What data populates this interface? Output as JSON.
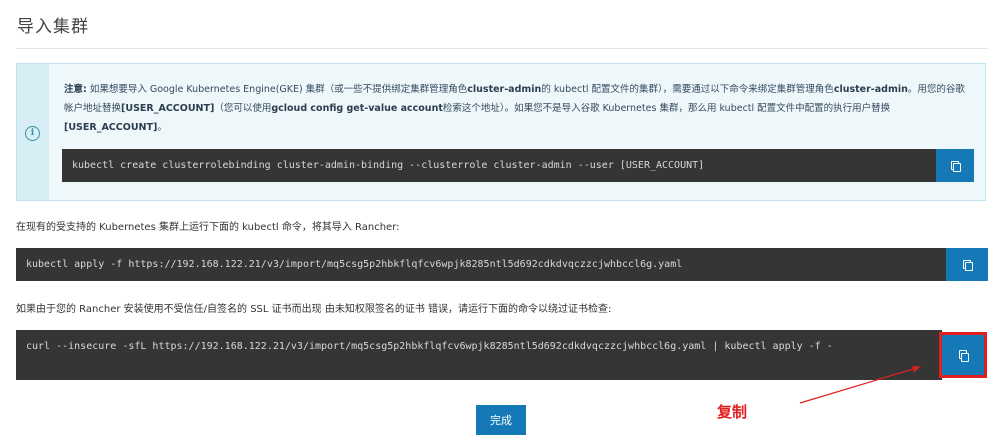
{
  "page": {
    "title": "导入集群"
  },
  "info_box": {
    "icon": "info-circle-icon",
    "note_prefix": "注意:",
    "note_1": " 如果想要导入 Google Kubernetes Engine(GKE) 集群（或一些不提供绑定集群管理角色",
    "note_b1": "cluster-admin",
    "note_2": "的 kubectl 配置文件的集群），需要通过以下命令来绑定集群管理角色",
    "note_b2": "cluster-admin",
    "note_3": "。用您的谷歌帐户地址替换",
    "note_b3": "[USER_ACCOUNT]",
    "note_4": "（您可以使用",
    "note_b4": "gcloud config get-value account",
    "note_5": "检索这个地址）。如果您不是导入谷歌 Kubernetes 集群，那么用 kubectl 配置文件中配置的执行用户替换",
    "note_b5": "[USER_ACCOUNT]",
    "note_6": "。",
    "command": "kubectl create clusterrolebinding cluster-admin-binding --clusterrole cluster-admin --user [USER_ACCOUNT]"
  },
  "section_import": {
    "label": "在现有的受支持的 Kubernetes 集群上运行下面的 kubectl 命令，将其导入 Rancher:",
    "command": "kubectl apply -f https://192.168.122.21/v3/import/mq5csg5p2hbkflqfcv6wpjk8285ntl5d692cdkdvqczzcjwhbccl6g.yaml"
  },
  "section_insecure": {
    "label": "如果由于您的 Rancher 安装使用不受信任/自签名的 SSL 证书而出现 由未知权限签名的证书 错误，请运行下面的命令以绕过证书检查:",
    "command": "curl --insecure -sfL https://192.168.122.21/v3/import/mq5csg5p2hbkflqfcv6wpjk8285ntl5d692cdkdvqczzcjwhbccl6g.yaml | kubectl apply -f -"
  },
  "buttons": {
    "done": "完成",
    "copy_icon": "copy-icon"
  },
  "annotation": {
    "text": "复制",
    "color": "#e02020"
  },
  "colors": {
    "accent": "#1679b7",
    "code_bg": "#353535",
    "info_bg": "#eef8fb"
  }
}
